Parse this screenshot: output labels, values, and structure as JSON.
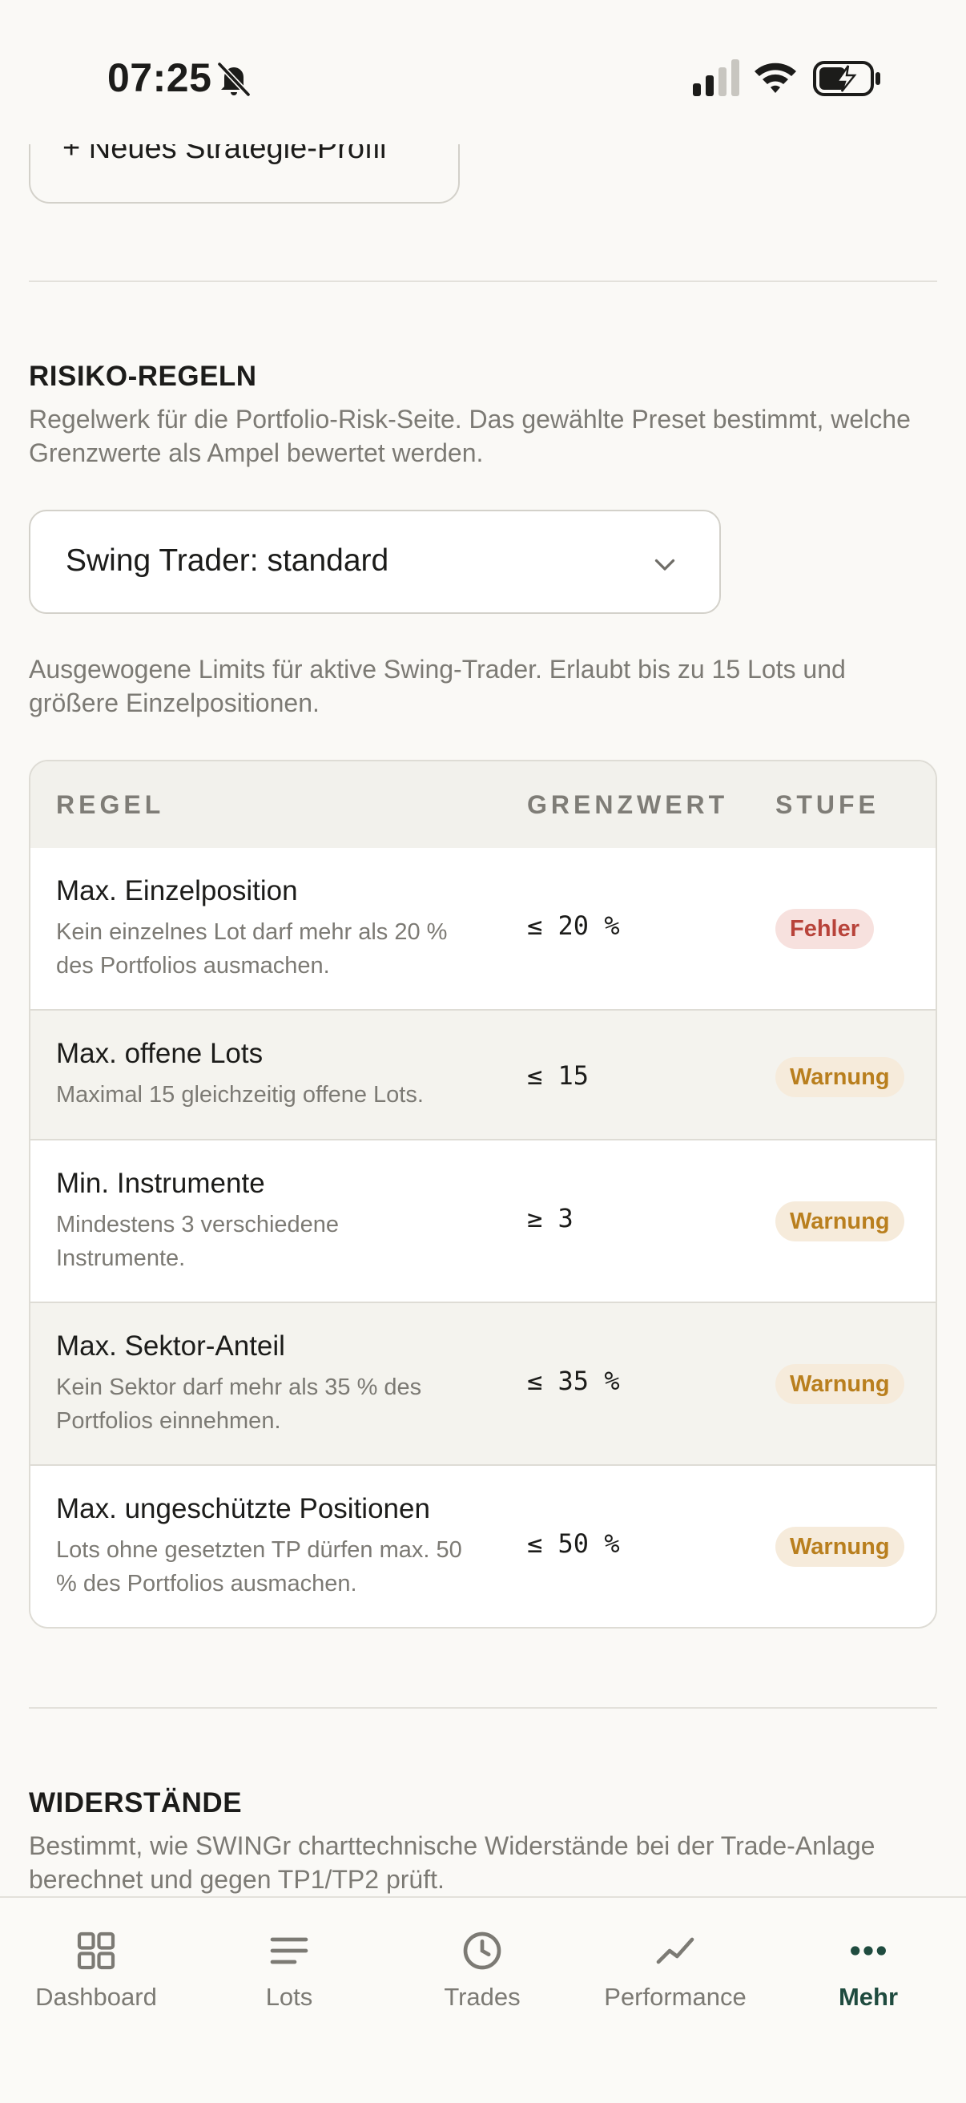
{
  "status_bar": {
    "time": "07:25",
    "icons": [
      "bell-slash-icon",
      "signal-icon",
      "wifi-icon",
      "battery-charging-icon"
    ]
  },
  "strategy_profile": {
    "new_profile_label": "+ Neues Strategie-Profil"
  },
  "risk_rules": {
    "title": "RISIKO-REGELN",
    "description": "Regelwerk für die Portfolio-Risk-Seite. Das gewählte Preset bestimmt, welche Grenzwerte als Ampel bewertet werden.",
    "preset_select": {
      "value": "Swing Trader: standard"
    },
    "preset_description": "Ausgewogene Limits für aktive Swing-Trader. Erlaubt bis zu 15 Lots und größere Einzelpositionen.",
    "table": {
      "headers": {
        "rule": "REGEL",
        "limit": "GRENZWERT",
        "level": "STUFE"
      },
      "rows": [
        {
          "title": "Max. Einzelposition",
          "description": "Kein einzelnes Lot darf mehr als 20 % des Portfolios ausmachen.",
          "limit": "≤ 20 %",
          "level": "Fehler",
          "level_color": "#B8433A"
        },
        {
          "title": "Max. offene Lots",
          "description": "Maximal 15 gleichzeitig offene Lots.",
          "limit": "≤ 15",
          "level": "Warnung",
          "level_color": "#B97F1E"
        },
        {
          "title": "Min. Instrumente",
          "description": "Mindestens 3 verschiedene Instrumente.",
          "limit": "≥ 3",
          "level": "Warnung",
          "level_color": "#B97F1E"
        },
        {
          "title": "Max. Sektor-Anteil",
          "description": "Kein Sektor darf mehr als 35 % des Portfolios einnehmen.",
          "limit": "≤ 35 %",
          "level": "Warnung",
          "level_color": "#B97F1E"
        },
        {
          "title": "Max. ungeschützte Positionen",
          "description": "Lots ohne gesetzten TP dürfen max. 50 % des Portfolios ausmachen.",
          "limit": "≤ 50 %",
          "level": "Warnung",
          "level_color": "#B97F1E"
        }
      ]
    }
  },
  "resistances": {
    "title": "WIDERSTÄNDE",
    "description": "Bestimmt, wie SWINGr charttechnische Widerstände bei der Trade-Anlage berechnet und gegen TP1/TP2 prüft."
  },
  "tab_bar": {
    "active_color": "#1F4B3F",
    "tabs": [
      {
        "label": "Dashboard",
        "icon": "grid-icon"
      },
      {
        "label": "Lots",
        "icon": "lines-icon"
      },
      {
        "label": "Trades",
        "icon": "clock-icon"
      },
      {
        "label": "Performance",
        "icon": "trend-icon"
      },
      {
        "label": "Mehr",
        "icon": "more-dots-icon",
        "active": true
      }
    ]
  }
}
